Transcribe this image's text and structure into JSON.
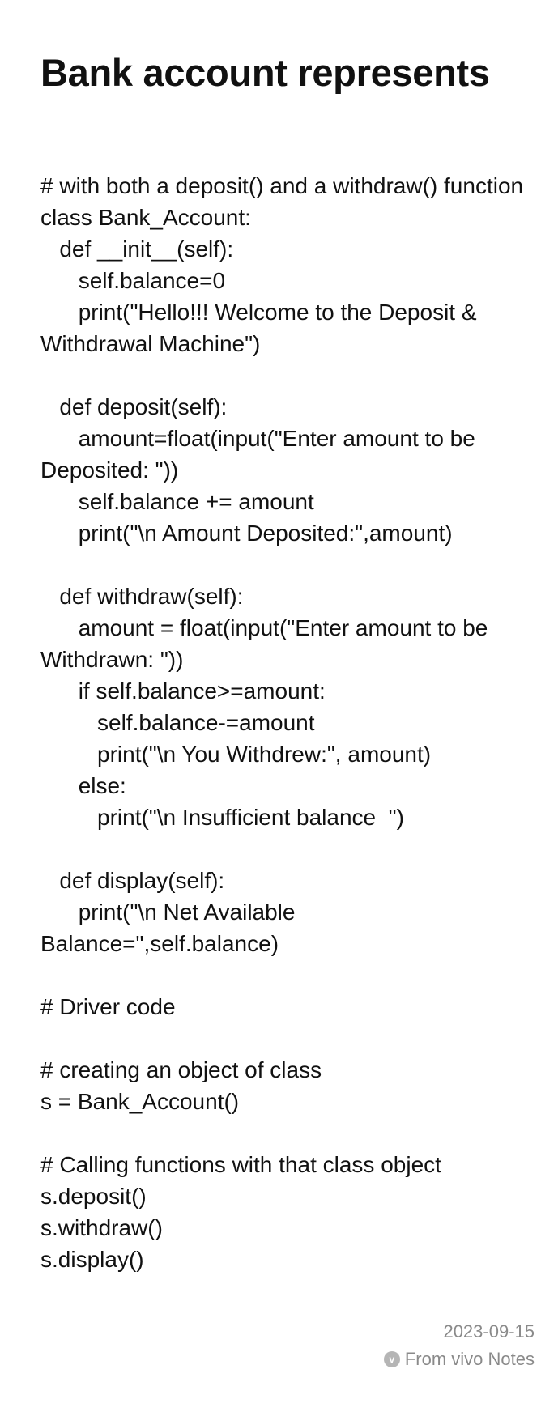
{
  "note": {
    "title": "Bank account represents",
    "lines": [
      "# with both a deposit() and a withdraw() function",
      "class Bank_Account:",
      "   def __init__(self):",
      "      self.balance=0",
      "      print(\"Hello!!! Welcome to the Deposit & Withdrawal Machine\")",
      "",
      "   def deposit(self):",
      "      amount=float(input(\"Enter amount to be Deposited: \"))",
      "      self.balance += amount",
      "      print(\"\\n Amount Deposited:\",amount)",
      "",
      "   def withdraw(self):",
      "      amount = float(input(\"Enter amount to be Withdrawn: \"))",
      "      if self.balance>=amount:",
      "         self.balance-=amount",
      "         print(\"\\n You Withdrew:\", amount)",
      "      else:",
      "         print(\"\\n Insufficient balance  \")",
      "",
      "   def display(self):",
      "      print(\"\\n Net Available Balance=\",self.balance)",
      "",
      "# Driver code",
      "",
      "# creating an object of class",
      "s = Bank_Account()",
      "",
      "# Calling functions with that class object",
      "s.deposit()",
      "s.withdraw()",
      "s.display()"
    ]
  },
  "footer": {
    "date": "2023-09-15",
    "source_label": "From vivo Notes",
    "source_icon": "vivo-logo-icon",
    "source_icon_glyph": "v"
  }
}
